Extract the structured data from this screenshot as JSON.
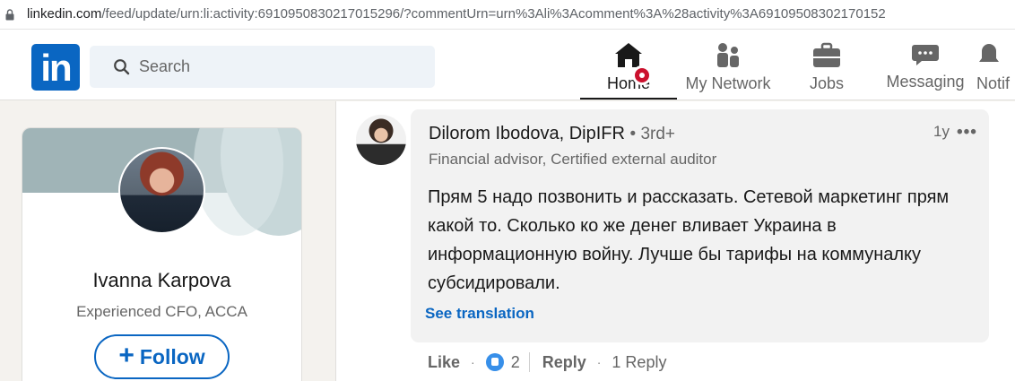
{
  "browser": {
    "url_main": "linkedin.com",
    "url_rest": "/feed/update/urn:li:activity:6910950830217015296/?commentUrn=urn%3Ali%3Acomment%3A%28activity%3A69109508302170152"
  },
  "header": {
    "logo_text": "in",
    "search": {
      "placeholder": "Search",
      "value": ""
    },
    "nav": {
      "home": "Home",
      "network": "My Network",
      "jobs": "Jobs",
      "messaging": "Messaging",
      "notifications": "Notif"
    }
  },
  "profile": {
    "name": "Ivanna Karpova",
    "headline": "Experienced CFO, ACCA",
    "follow_label": "Follow"
  },
  "comment": {
    "author": "Dilorom Ibodova, DipIFR",
    "degree": "• 3rd+",
    "headline": "Financial advisor, Certified external auditor",
    "time": "1y",
    "more": "•••",
    "text": "Прям 5 надо позвонить и рассказать. Сетевой маркетинг прям какой то. Сколько ко же денег вливает Украина в информационную войну. Лучше бы тарифы на коммуналку субсидировали.",
    "see_translation": "See translation",
    "like_label": "Like",
    "reaction_count": "2",
    "reply_label": "Reply",
    "replies": "1 Reply",
    "dot": "·"
  },
  "colors": {
    "brand": "#0a66c2",
    "notification_badge": "#cb112d",
    "reaction_blue": "#378fe9"
  }
}
